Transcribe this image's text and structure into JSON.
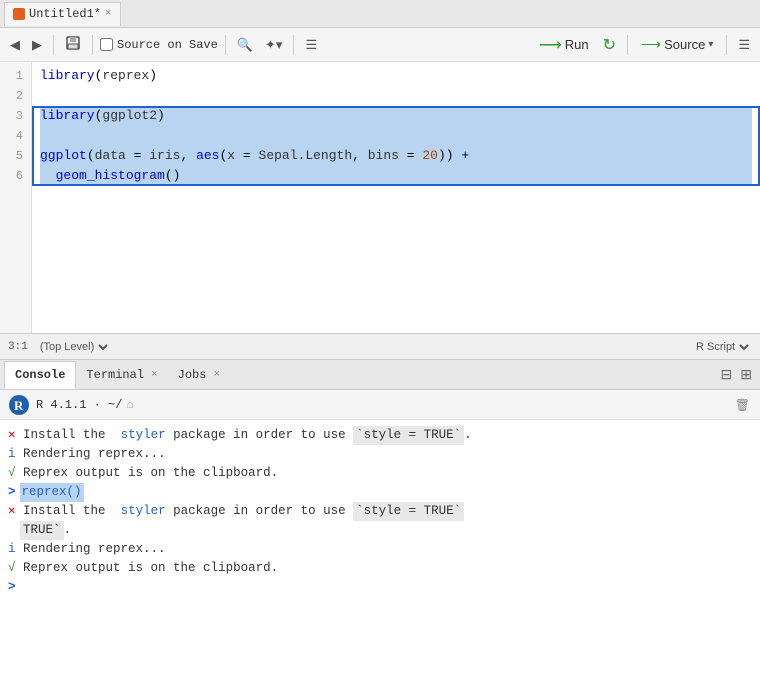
{
  "editor": {
    "tab_title": "Untitled1*",
    "tab_close": "×",
    "toolbar": {
      "back_label": "◀",
      "forward_label": "▶",
      "save_label": "💾",
      "source_on_save_label": "Source on Save",
      "find_label": "🔍",
      "code_tools_label": "✦▾",
      "column_layout_label": "☰",
      "run_label": "Run",
      "rerun_label": "↻",
      "source_label": "Source",
      "source_dropdown_label": "▾",
      "menu_label": "☰"
    },
    "lines": [
      {
        "num": "1",
        "content": "library(reprex)",
        "selected": false
      },
      {
        "num": "2",
        "content": "",
        "selected": false
      },
      {
        "num": "3",
        "content": "library(ggplot2)",
        "selected": true
      },
      {
        "num": "4",
        "content": "",
        "selected": true
      },
      {
        "num": "5",
        "content": "ggplot(data = iris, aes(x = Sepal.Length, bins = 20)) +",
        "selected": true
      },
      {
        "num": "6",
        "content": "  geom_histogram()",
        "selected": true
      }
    ],
    "status": {
      "position": "3:1",
      "scope": "(Top Level)",
      "script_type": "R Script"
    }
  },
  "console": {
    "tabs": [
      {
        "label": "Console",
        "active": true
      },
      {
        "label": "Terminal",
        "active": false,
        "close": "×"
      },
      {
        "label": "Jobs",
        "active": false,
        "close": "×"
      }
    ],
    "r_version": "R 4.1.1 · ~/",
    "output": [
      {
        "type": "error",
        "prefix": "✕",
        "text": " Install the ",
        "highlight": "styler",
        "text2": " package in order to use ",
        "code": "`style = TRUE`",
        "text3": "."
      },
      {
        "type": "info",
        "prefix": "i",
        "text": " Rendering reprex..."
      },
      {
        "type": "ok",
        "prefix": "√",
        "text": " Reprex output is on the clipboard."
      },
      {
        "type": "cmd",
        "prefix": ">",
        "text": "reprex()"
      },
      {
        "type": "error",
        "prefix": "✕",
        "text": " Install the ",
        "highlight": "styler",
        "text2": " package in order to use ",
        "code": "`style = TRUE`",
        "text3": "."
      },
      {
        "type": "info",
        "prefix": "i",
        "text": " Rendering reprex..."
      },
      {
        "type": "ok",
        "prefix": "√",
        "text": " Reprex output is on the clipboard."
      },
      {
        "type": "prompt",
        "prefix": ">",
        "text": ""
      }
    ]
  }
}
